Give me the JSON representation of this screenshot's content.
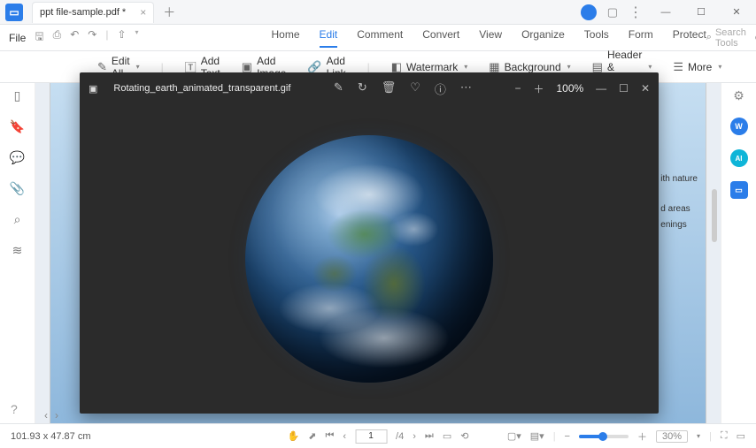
{
  "titlebar": {
    "tab_title": "ppt file-sample.pdf *"
  },
  "menubar": {
    "file": "File",
    "items": [
      "Home",
      "Edit",
      "Comment",
      "Convert",
      "View",
      "Organize",
      "Tools",
      "Form",
      "Protect"
    ],
    "search_placeholder": "Search Tools"
  },
  "toolbar": {
    "edit_all": "Edit All",
    "add_text": "Add Text",
    "add_image": "Add Image",
    "add_link": "Add Link",
    "watermark": "Watermark",
    "background": "Background",
    "header_footer": "Header & Footer",
    "more": "More"
  },
  "viewer": {
    "filename": "Rotating_earth_animated_transparent.gif",
    "zoom": "100%"
  },
  "doc_text": {
    "l1": "ith nature",
    "l2": "d areas",
    "l3": "enings"
  },
  "statusbar": {
    "coords": "101.93 x 47.87 cm",
    "page": "1",
    "page_total": "/4",
    "zoom": "30%"
  }
}
